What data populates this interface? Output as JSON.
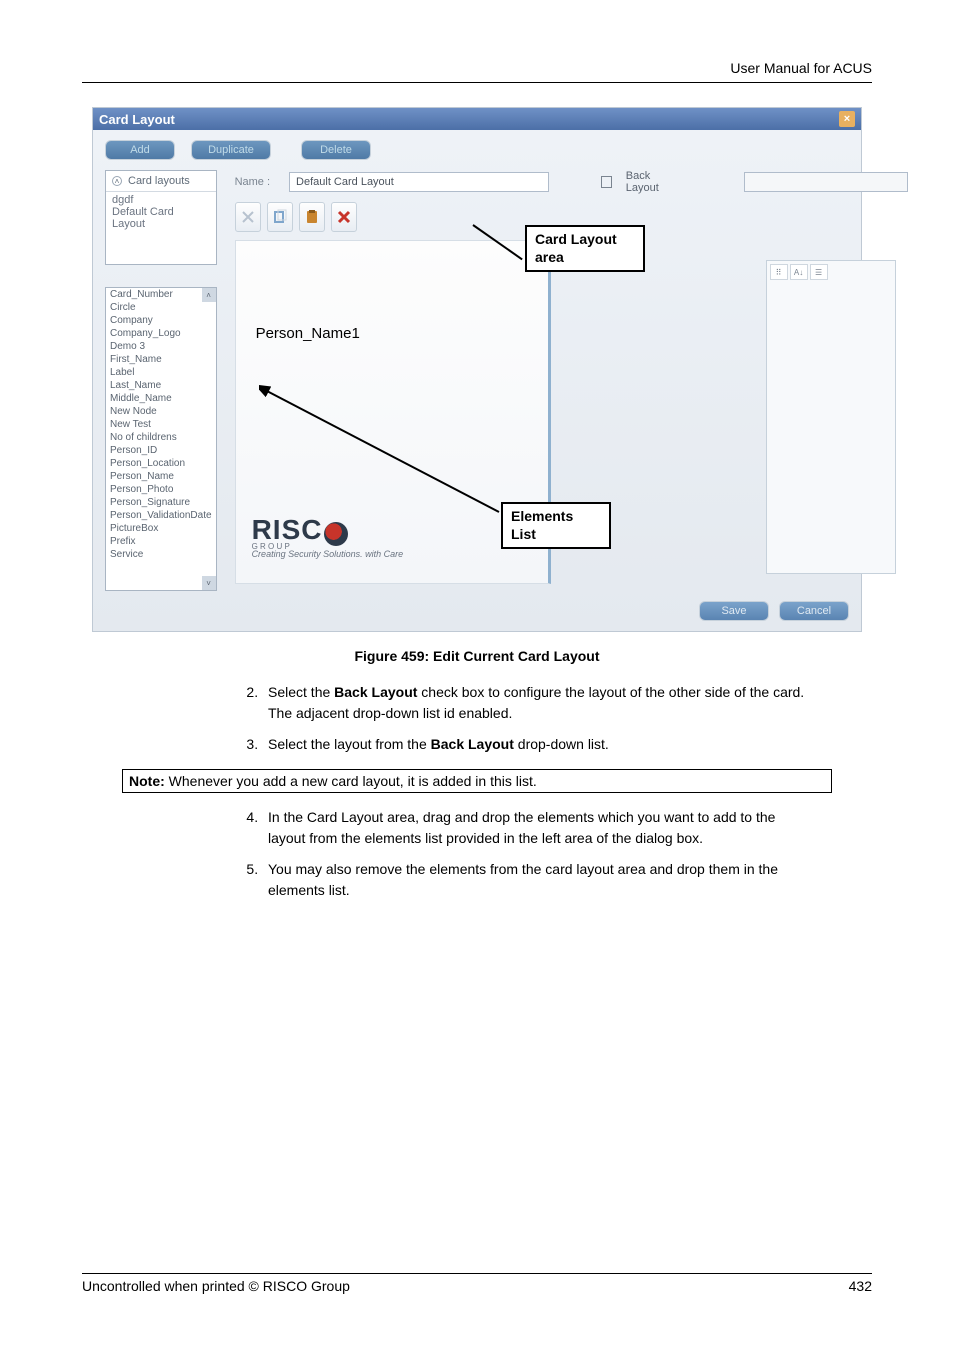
{
  "page": {
    "header_right": "User Manual for ACUS",
    "footer_left": "Uncontrolled when printed © RISCO Group",
    "footer_right": "432"
  },
  "dialog": {
    "title": "Card Layout",
    "close": "×",
    "buttons": {
      "add": "Add",
      "duplicate": "Duplicate",
      "delete": "Delete"
    },
    "left": {
      "layouts_header": "Card layouts",
      "layouts": [
        "dgdf",
        "Default Card Layout"
      ],
      "elements": [
        "Card_Number",
        "Circle",
        "Company",
        "Company_Logo",
        "Demo 3",
        "First_Name",
        "Label",
        "Last_Name",
        "Middle_Name",
        "New Node",
        "New Test",
        "No of childrens",
        "Person_ID",
        "Person_Location",
        "Person_Name",
        "Person_Photo",
        "Person_Signature",
        "Person_ValidationDate",
        "PictureBox",
        "Prefix",
        "Service"
      ]
    },
    "right": {
      "name_label": "Name :",
      "name_value": "Default Card Layout",
      "back_label": "Back Layout",
      "placeholder": "Person_Name1",
      "logo_tag": "Creating Security Solutions.",
      "logo_tag2": "with Care",
      "group_letters": [
        "G",
        "R",
        "O",
        "U",
        "P"
      ]
    },
    "prop_icons": [
      "⠿",
      "A↓",
      "☰"
    ],
    "callouts": {
      "area": "Card Layout area",
      "elements": "Elements List"
    },
    "footer_buttons": {
      "save": "Save",
      "cancel": "Cancel"
    }
  },
  "figure_caption": "Figure 459: Edit Current Card Layout",
  "steps_a": [
    {
      "n": "2.",
      "html": "Select the <b>Back Layout</b> check box to configure the layout of the other side of the card. The adjacent drop-down list id enabled."
    },
    {
      "n": "3.",
      "html": "Select the layout from the <b>Back Layout</b> drop-down list."
    }
  ],
  "note": {
    "label": "Note:",
    "text": " Whenever you add a new card layout, it is added in this list."
  },
  "steps_b": [
    {
      "n": "4.",
      "html": "In the Card Layout area, drag and drop the elements which you want to add to the layout from the elements list provided in the left area of the dialog box."
    },
    {
      "n": "5.",
      "html": "You may also remove the elements from the card layout area and drop them in the elements list."
    }
  ]
}
